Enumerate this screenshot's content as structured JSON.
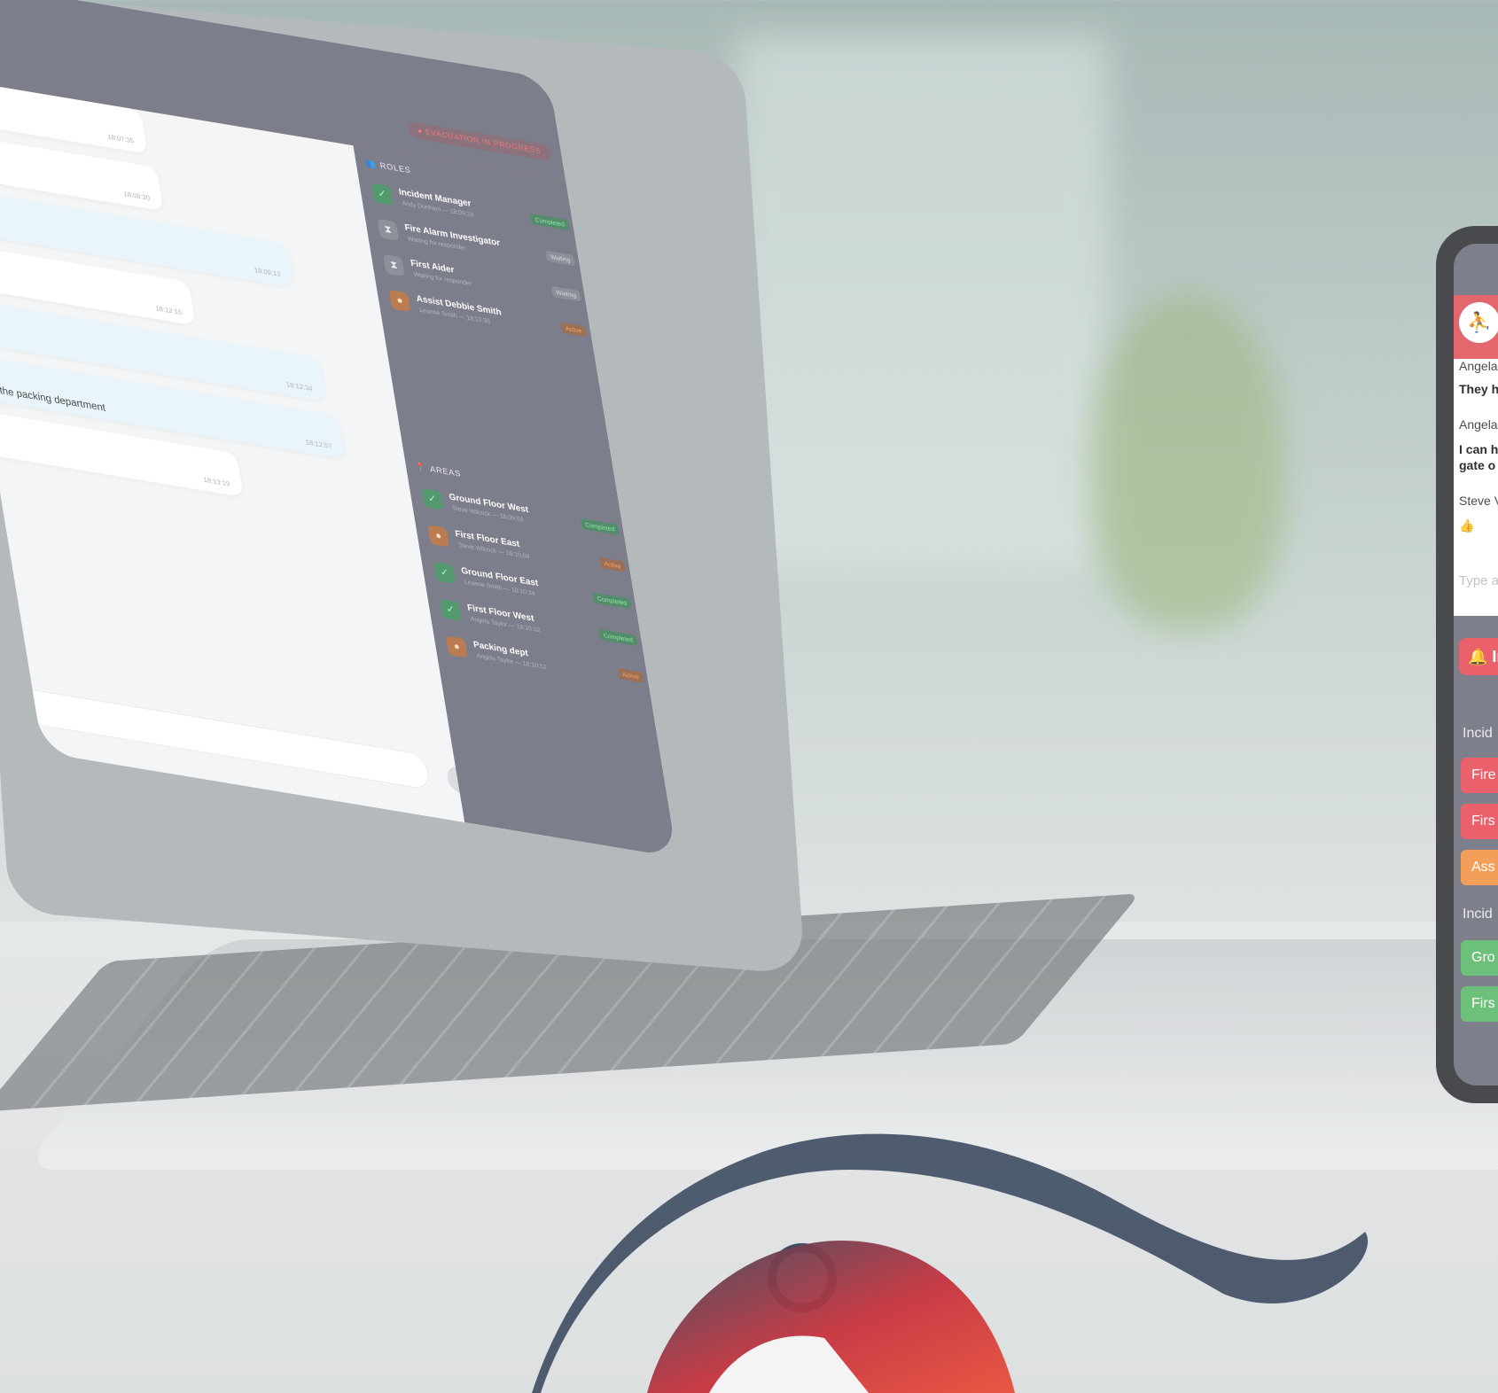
{
  "laptop": {
    "status_badge": "● EVACUATION IN PROGRESS",
    "messages": [
      {
        "time": "18:07:35",
        "text": ""
      },
      {
        "time": "18:08:20",
        "text": ""
      },
      {
        "time": "18:09:13",
        "text": ""
      },
      {
        "time": "18:12:16",
        "text": ""
      },
      {
        "time": "18:12:34",
        "text": ""
      },
      {
        "time": "18:12:57",
        "text": "ed the packing department"
      },
      {
        "time": "18:13:19",
        "text": ""
      }
    ],
    "roles_title": "ROLES",
    "roles": [
      {
        "name": "Incident Manager",
        "sub": "Andy Dunham — 18:09:24",
        "status": "Completed",
        "state": "done"
      },
      {
        "name": "Fire Alarm Investigator",
        "sub": "Waiting for responder",
        "status": "Waiting",
        "state": "wait"
      },
      {
        "name": "First Aider",
        "sub": "Waiting for responder",
        "status": "Waiting",
        "state": "wait"
      },
      {
        "name": "Assist Debbie Smith",
        "sub": "Leanne Smith — 18:10:38",
        "status": "Active",
        "state": "act"
      }
    ],
    "areas_title": "AREAS",
    "areas": [
      {
        "name": "Ground Floor West",
        "sub": "Steve Wilcock — 18:09:59",
        "status": "Completed",
        "state": "done"
      },
      {
        "name": "First Floor East",
        "sub": "Steve Wilcock — 18:10:08",
        "status": "Active",
        "state": "act"
      },
      {
        "name": "Ground Floor East",
        "sub": "Leanne Smith — 18:10:34",
        "status": "Completed",
        "state": "done"
      },
      {
        "name": "First Floor West",
        "sub": "Angela Taylor — 18:10:02",
        "status": "Completed",
        "state": "done"
      },
      {
        "name": "Packing dept",
        "sub": "Angela Taylor — 18:10:12",
        "status": "Active",
        "state": "act"
      }
    ]
  },
  "phone": {
    "chat_lines": [
      "Angela",
      "They h",
      "Angela",
      "I can h",
      "gate o",
      "Steve V",
      "👍"
    ],
    "input_placeholder": "Type a",
    "alert_button": "🔔 In",
    "roles_label": "Incid",
    "role_buttons": [
      {
        "label": "Fire",
        "color": "#e84a57"
      },
      {
        "label": "Firs",
        "color": "#e84a57"
      },
      {
        "label": "Ass",
        "color": "#f29242"
      }
    ],
    "areas_label": "Incid",
    "area_buttons": [
      {
        "label": "Gro",
        "color": "#59b867"
      },
      {
        "label": "Firs",
        "color": "#59b867"
      }
    ]
  },
  "colors": {
    "accent": "#f08a3a",
    "alert": "#e05259",
    "done": "#3d8b5a",
    "sidebar": "#6b6d7b"
  }
}
